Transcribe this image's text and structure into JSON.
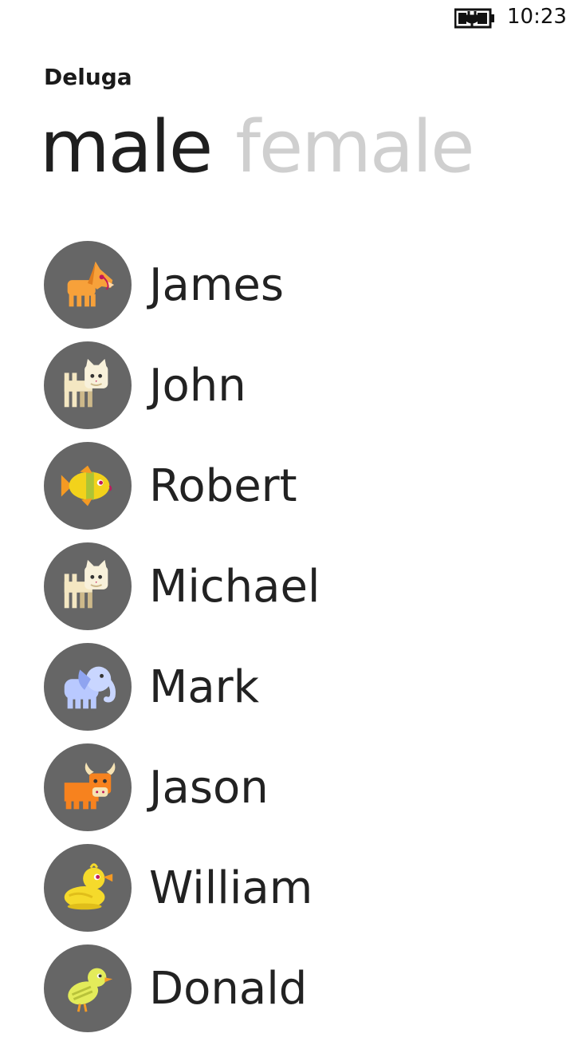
{
  "status_bar": {
    "time": "10:23",
    "battery_icon": "battery-charging-icon"
  },
  "app": {
    "title": "Deluga"
  },
  "pivot": {
    "items": [
      {
        "label": "male",
        "active": true
      },
      {
        "label": "female",
        "active": false
      }
    ]
  },
  "list": {
    "items": [
      {
        "name": "James",
        "icon": "horse-icon",
        "colors": {
          "primary": "#F7A13A",
          "secondary": "#FFD9A8"
        }
      },
      {
        "name": "John",
        "icon": "cat-icon",
        "colors": {
          "primary": "#F4E7C2",
          "secondary": "#CDB98A"
        }
      },
      {
        "name": "Robert",
        "icon": "fish-icon",
        "colors": {
          "primary": "#F2D21B",
          "secondary": "#F59A23"
        }
      },
      {
        "name": "Michael",
        "icon": "cat-icon",
        "colors": {
          "primary": "#F4E7C2",
          "secondary": "#CDB98A"
        }
      },
      {
        "name": "Mark",
        "icon": "elephant-icon",
        "colors": {
          "primary": "#B9C9FF",
          "secondary": "#8FA4F0"
        }
      },
      {
        "name": "Jason",
        "icon": "cow-icon",
        "colors": {
          "primary": "#F7821E",
          "secondary": "#F5E3B5"
        }
      },
      {
        "name": "William",
        "icon": "duck-icon",
        "colors": {
          "primary": "#F5DA2B",
          "secondary": "#F59A23"
        }
      },
      {
        "name": "Donald",
        "icon": "chick-icon",
        "colors": {
          "primary": "#E3EB5A",
          "secondary": "#F59A23"
        }
      }
    ]
  },
  "colors": {
    "avatar_bg": "#666666",
    "pivot_active": "#1f1f1f",
    "pivot_inactive": "#cfcfcf",
    "text": "#222222",
    "background": "#ffffff"
  }
}
